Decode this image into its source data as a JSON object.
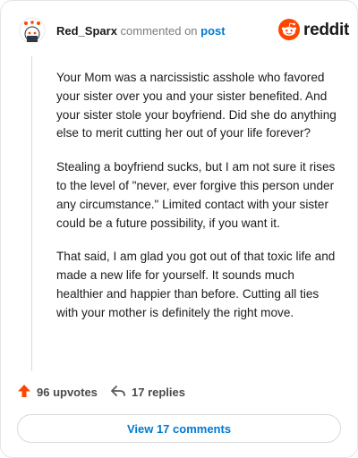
{
  "comment": {
    "username": "Red_Sparx",
    "action_text": "commented on",
    "post_link": "post",
    "paragraphs": [
      "Your Mom was a narcissistic asshole who favored your sister over you and your sister benefited. And your sister stole your boyfriend. Did she do anything else to merit cutting her out of your life forever?",
      "Stealing a boyfriend sucks, but I am not sure it rises to the level of \"never, ever forgive this person under any circumstance.\" Limited contact with your sister could be a future possibility, if you want it.",
      "That said, I am glad you got out of that toxic life and made a new life for yourself. It sounds much healthier and happier than before. Cutting all ties with your mother is definitely the right move."
    ]
  },
  "brand": {
    "name": "reddit",
    "icon": "reddit-logo-icon",
    "color": "#ff4500"
  },
  "actions": {
    "upvotes": "96 upvotes",
    "replies": "17 replies",
    "upvote_icon": "upvote-arrow-icon",
    "reply_icon": "reply-arrow-icon"
  },
  "view_button": {
    "label": "View 17 comments"
  },
  "colors": {
    "accent": "#0079d3",
    "upvote": "#ff4500"
  }
}
